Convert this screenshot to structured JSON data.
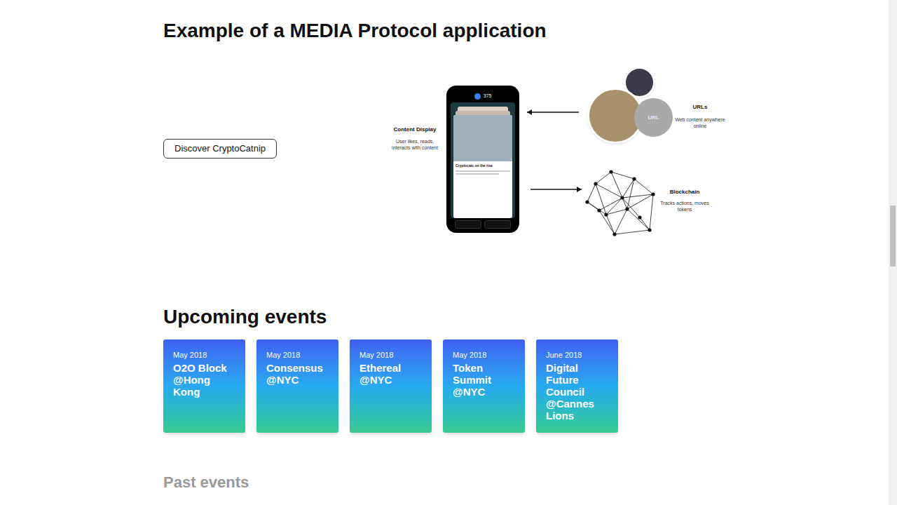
{
  "page": {
    "title": "Example of a MEDIA Protocol application",
    "button": "Discover CryptoCatnip"
  },
  "diagram": {
    "content_display": {
      "title": "Content Display",
      "caption": "User likes, reads, interacts with content"
    },
    "urls": {
      "title": "URLs",
      "caption": "Web content anywhere online",
      "bubble": "URL"
    },
    "blockchain": {
      "title": "Blockchain",
      "caption": "Tracks actions, moves tokens"
    },
    "phone": {
      "balance": "375",
      "card_title": "Cryptocats on the rise"
    }
  },
  "upcoming": {
    "title": "Upcoming events",
    "events": [
      {
        "date": "May 2018",
        "name": "O2O Block @Hong Kong"
      },
      {
        "date": "May 2018",
        "name": "Consensus @NYC"
      },
      {
        "date": "May 2018",
        "name": "Ethereal @NYC"
      },
      {
        "date": "May 2018",
        "name": "Token Summit @NYC"
      },
      {
        "date": "June 2018",
        "name": "Digital Future Council @Cannes Lions"
      }
    ]
  },
  "past": {
    "title": "Past events"
  }
}
